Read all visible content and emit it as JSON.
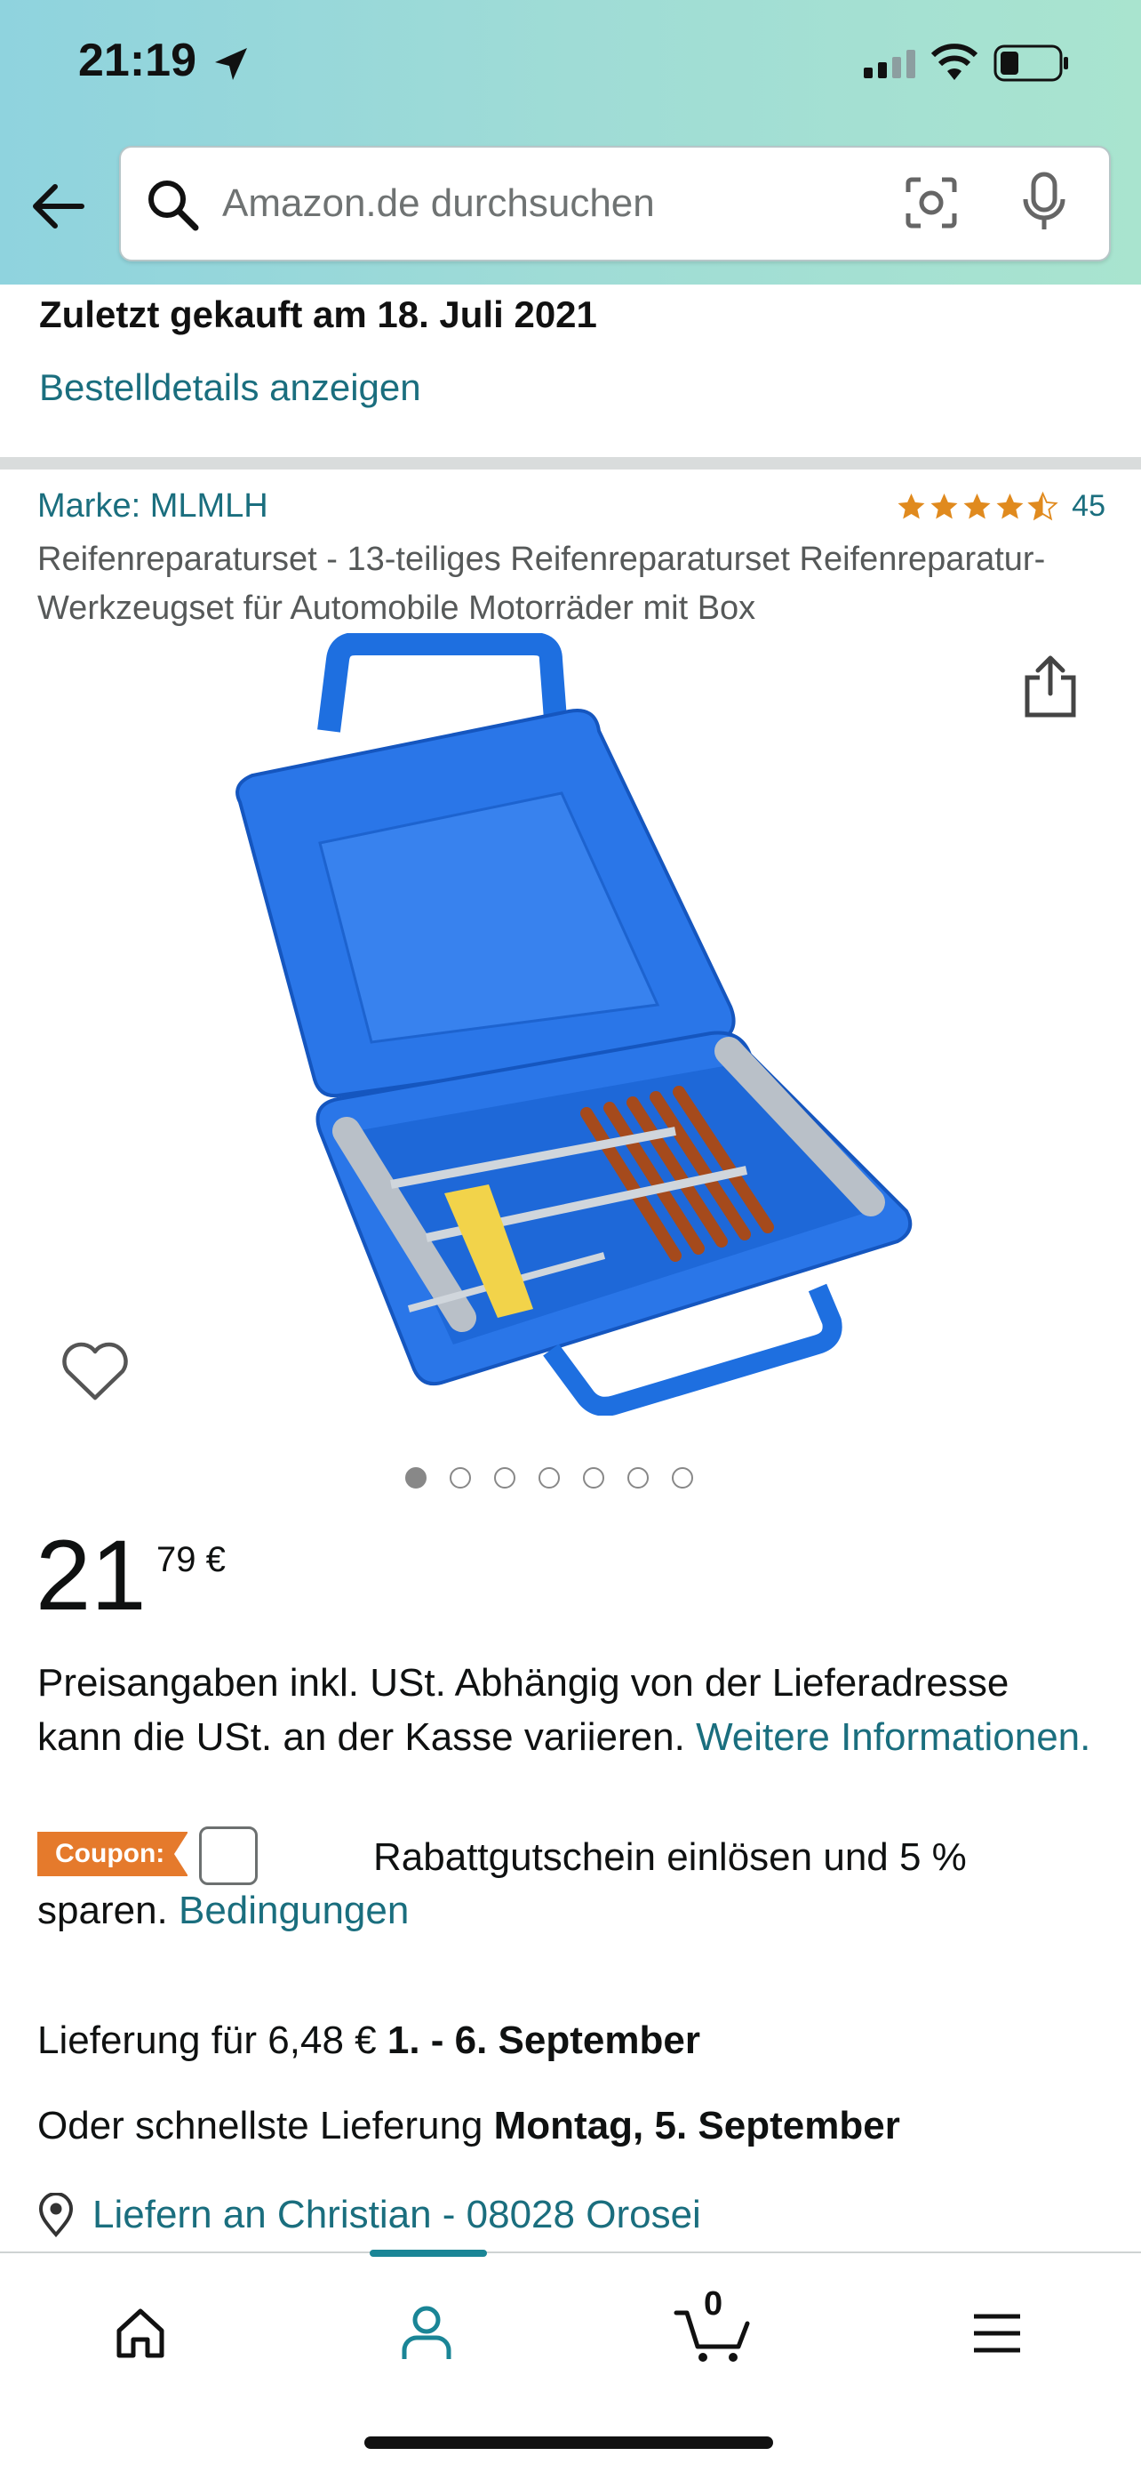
{
  "status_bar": {
    "time": "21:19"
  },
  "search": {
    "placeholder": "Amazon.de durchsuchen"
  },
  "order": {
    "last_bought": "Zuletzt gekauft am 18. Juli 2021",
    "details_link": "Bestelldetails anzeigen"
  },
  "product": {
    "brand": "Marke: MLMLH",
    "rating": 4.5,
    "review_count": "45",
    "title": "Reifenreparaturset - 13-teiliges Reifenreparaturset Reifenreparatur-Werkzeugset für Automobile Motorräder mit Box",
    "image_count": 7,
    "active_image": 1
  },
  "price": {
    "whole": "21",
    "fraction": "79 €",
    "vat_text": "Preisangaben inkl. USt. Abhängig von der Lieferadresse kann die USt. an der Kasse variieren. ",
    "vat_link": "Weitere Informationen."
  },
  "coupon": {
    "badge": "Coupon:",
    "text_line1": "Rabattgutschein einlösen und 5 %",
    "text_line2_prefix": "sparen. ",
    "conditions_link": "Bedingungen"
  },
  "delivery": {
    "line1_prefix": "Lieferung für 6,48 € ",
    "line1_bold": "1. - 6. September",
    "line2_prefix": "Oder schnellste Lieferung ",
    "line2_bold": "Montag, 5. September",
    "deliver_to": "Liefern an Christian - 08028 Orosei"
  },
  "tabbar": {
    "cart_count": "0",
    "active_tab": "account"
  },
  "colors": {
    "link": "#1a6e7e",
    "star": "#e08a1e",
    "coupon": "#e57a2c",
    "case_blue": "#1e6fe0",
    "header_gradient_start": "#8fd3de",
    "header_gradient_end": "#a9e4cf"
  }
}
